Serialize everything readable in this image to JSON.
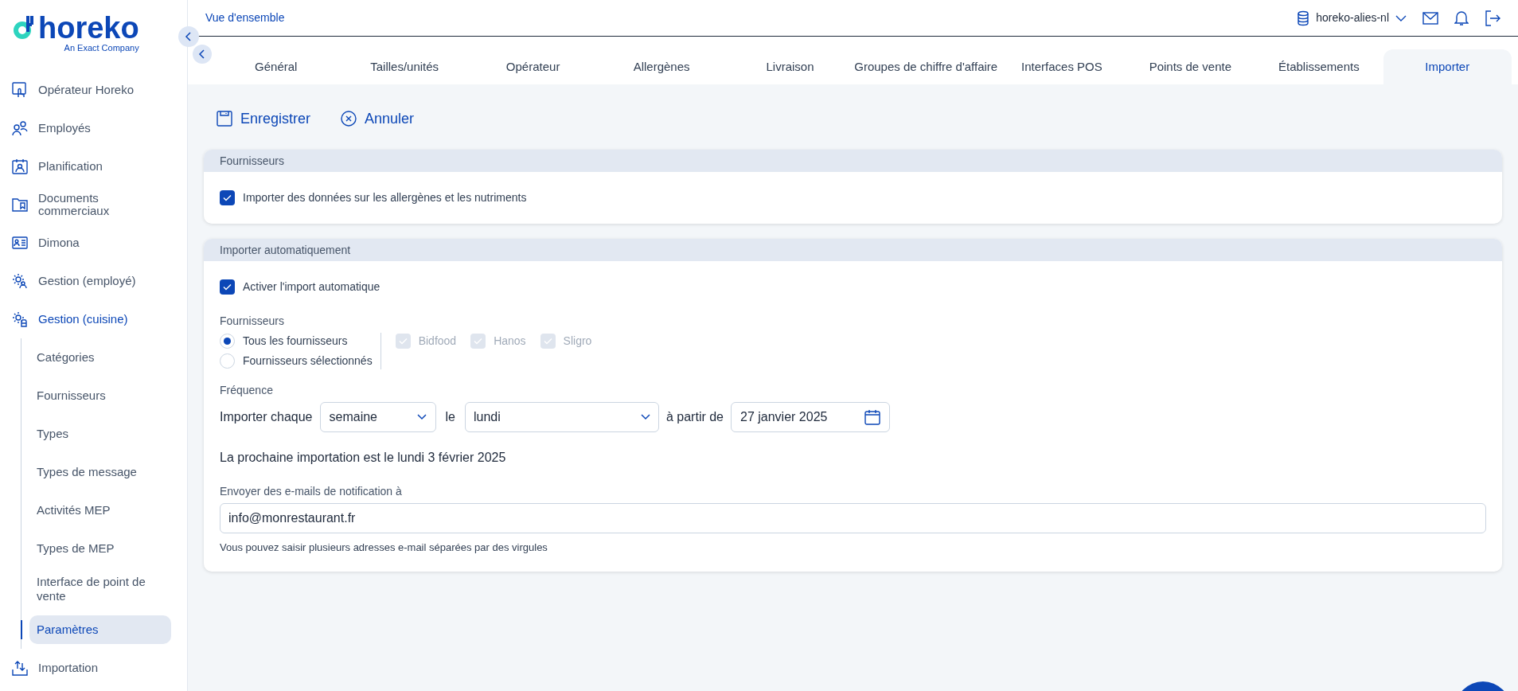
{
  "logo": {
    "wordmark": "horeko",
    "tagline": "An Exact Company"
  },
  "sidebar": {
    "items": [
      {
        "label": "Opérateur Horeko",
        "expanded": false
      },
      {
        "label": "Employés",
        "expanded": false
      },
      {
        "label": "Planification",
        "expanded": false
      },
      {
        "label": "Documents commerciaux",
        "expanded": false
      },
      {
        "label": "Dimona",
        "expanded": false
      },
      {
        "label": "Gestion (employé)",
        "expanded": false
      },
      {
        "label": "Gestion (cuisine)",
        "expanded": true,
        "children": [
          {
            "label": "Catégories",
            "selected": false
          },
          {
            "label": "Fournisseurs",
            "selected": false
          },
          {
            "label": "Types",
            "selected": false
          },
          {
            "label": "Types de message",
            "selected": false
          },
          {
            "label": "Activités MEP",
            "selected": false
          },
          {
            "label": "Types de MEP",
            "selected": false
          },
          {
            "label": "Interface de point de vente",
            "selected": false
          },
          {
            "label": "Paramètres",
            "selected": true
          }
        ]
      },
      {
        "label": "Importation",
        "expanded": false
      }
    ]
  },
  "header": {
    "breadcrumb": "Vue d'ensemble",
    "database": "horeko-alies-nl"
  },
  "tabs": [
    {
      "label": "Général",
      "selected": false
    },
    {
      "label": "Tailles/unités",
      "selected": false
    },
    {
      "label": "Opérateur",
      "selected": false
    },
    {
      "label": "Allergènes",
      "selected": false
    },
    {
      "label": "Livraison",
      "selected": false
    },
    {
      "label": "Groupes de chiffre d'affaire",
      "selected": false
    },
    {
      "label": "Interfaces POS",
      "selected": false
    },
    {
      "label": "Points de vente",
      "selected": false
    },
    {
      "label": "Établissements",
      "selected": false
    },
    {
      "label": "Importer",
      "selected": true
    }
  ],
  "toolbar": {
    "save": "Enregistrer",
    "cancel": "Annuler"
  },
  "suppliers_card": {
    "title": "Fournisseurs",
    "checkbox": {
      "label": "Importer des données sur les allergènes et les nutriments",
      "checked": true
    }
  },
  "auto_import_card": {
    "title": "Importer automatiquement",
    "enable": {
      "label": "Activer l'import automatique",
      "checked": true
    },
    "suppliers_label": "Fournisseurs",
    "supplier_mode": [
      {
        "label": "Tous les fournisseurs",
        "selected": true
      },
      {
        "label": "Fournisseurs sélectionnés",
        "selected": false
      }
    ],
    "supplier_checks": [
      {
        "label": "Bidfood",
        "checked": true,
        "disabled": true
      },
      {
        "label": "Hanos",
        "checked": true,
        "disabled": true
      },
      {
        "label": "Sligro",
        "checked": true,
        "disabled": true
      }
    ],
    "frequency_label": "Fréquence",
    "import_every": "Importer chaque",
    "period": "semaine",
    "le": "le",
    "day": "lundi",
    "from": "à partir de",
    "start_date": "27 janvier 2025",
    "next_import": "La prochaine importation est le lundi 3 février 2025",
    "email_label": "Envoyer des e-mails de notification à",
    "email": "info@monrestaurant.fr",
    "email_hint": "Vous pouvez saisir plusieurs adresses e-mail séparées par des virgules"
  }
}
